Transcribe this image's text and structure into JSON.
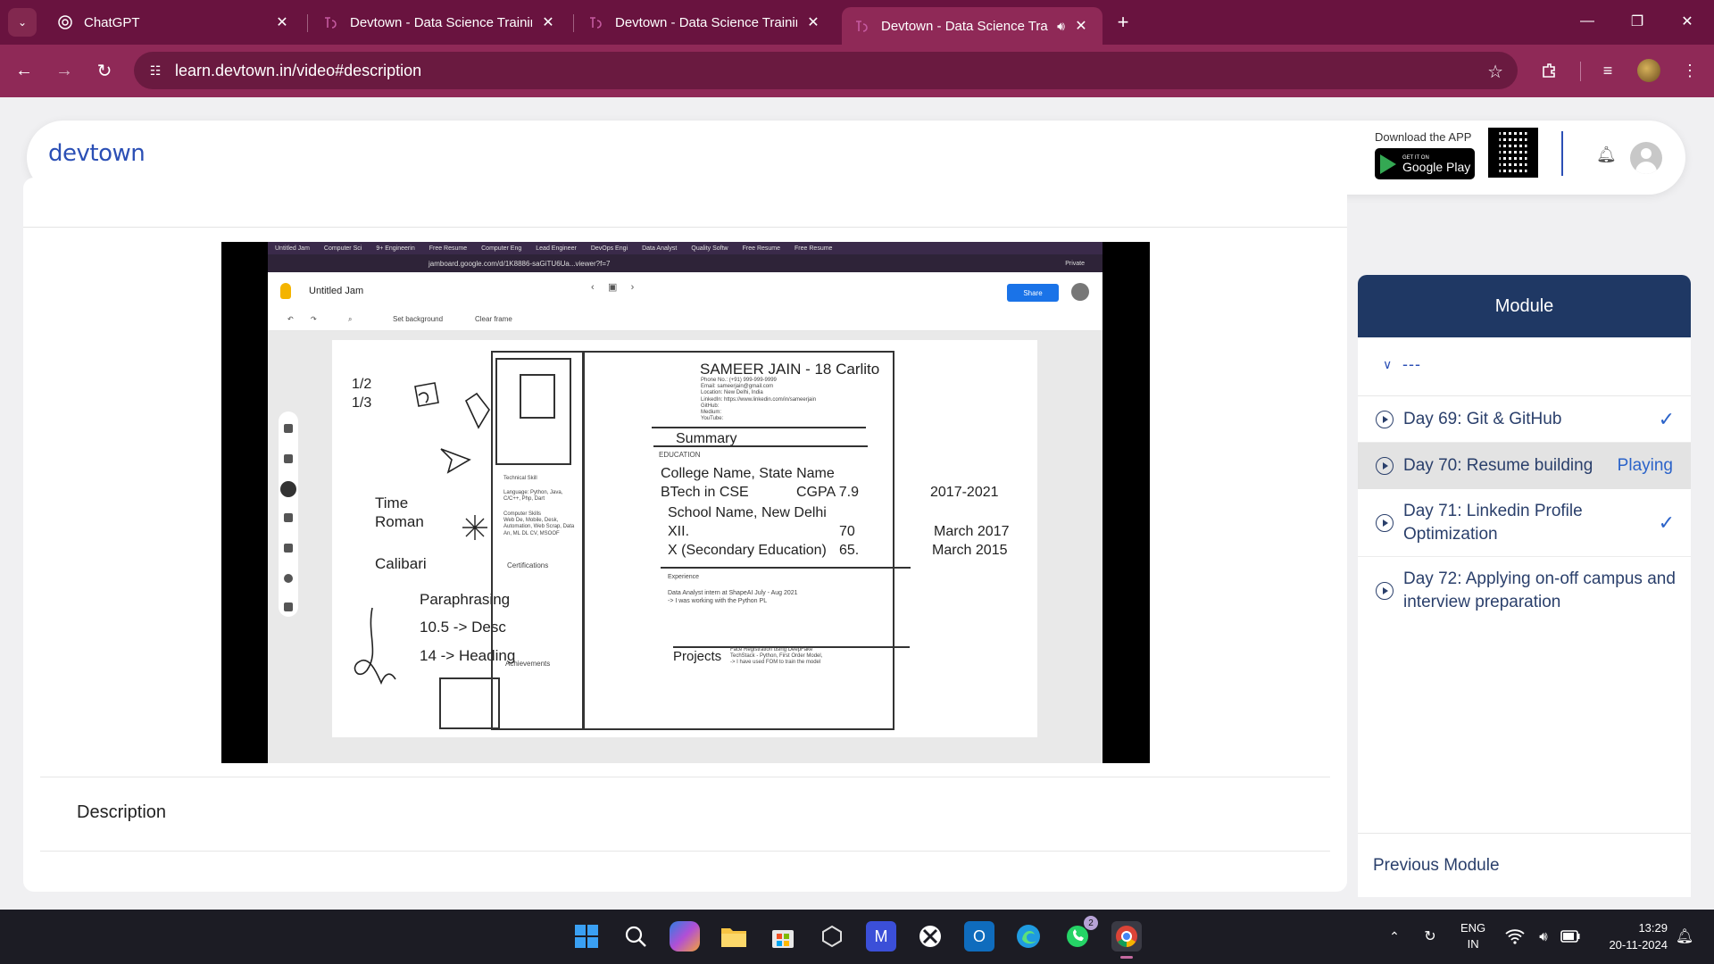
{
  "browser": {
    "tabs": [
      {
        "title": "ChatGPT",
        "icon": "chatgpt-icon"
      },
      {
        "title": "Devtown - Data Science Training",
        "icon": "devtown-icon"
      },
      {
        "title": "Devtown - Data Science Training",
        "icon": "devtown-icon"
      },
      {
        "title": "Devtown - Data Science Tra",
        "icon": "devtown-icon",
        "active": true
      }
    ],
    "url": "learn.devtown.in/video#description",
    "accent": "#8f2957",
    "tabstrip_color": "#69133f"
  },
  "header": {
    "logo": "devtown",
    "download_label": "Download the APP",
    "play_small": "GET IT ON",
    "play_big": "Google Play"
  },
  "video": {
    "jam_title": "Untitled Jam",
    "jam_url": "jamboard.google.com/d/1K8886-saGiTU6Ua...viewer?f=7",
    "share_label": "Share",
    "set_background": "Set background",
    "clear_frame": "Clear frame",
    "private_label": "Private",
    "board": {
      "name_line": "SAMEER JAIN - 18 Carlito",
      "ratio1": "1/2",
      "ratio2": "1/3",
      "font1": "Time\nRoman",
      "font2": "Calibari",
      "para1": "Paraphrasing",
      "para2": "10.5 -> Desc",
      "para3": "14 -> Heading",
      "summary": "Summary",
      "education": "EDUCATION",
      "college": "College Name, State Name",
      "btech": "BTech in CSE",
      "cgpa": "CGPA 7.9",
      "years": "2017-2021",
      "school": "School Name, New Delhi",
      "xii": "XII.",
      "xii_score": "70",
      "xii_date": "March 2017",
      "x": "X (Secondary Education)",
      "x_score": "65.",
      "x_date": "March 2015",
      "technical_skill": "Technical Skill",
      "languages": "Language: Python, Java, C/C++, Php, Dart",
      "computer_skills": "Computer Skills\nWeb De, Mobile, Desk, Automation, Web Scrap, Data An, ML DL CV, MSOOF",
      "certifications": "Certifications",
      "experience": "Experience",
      "exp_line": "Data Analyst intern at ShapeAI     July - Aug 2021",
      "exp_detail": "-> I was working with the Python PL",
      "achievements": "Achievements",
      "projects": "Projects",
      "project_detail": "Face Registration using DeepFake\nTechStack - Python, First Order Model,\n-> I have used FOM to train the model"
    }
  },
  "description": {
    "label": "Description"
  },
  "module": {
    "title": "Module",
    "section_label": "---",
    "lessons": [
      {
        "title": "Day 69: Git & GitHub",
        "status": "done"
      },
      {
        "title": "Day 70: Resume building",
        "status": "Playing"
      },
      {
        "title": "Day 71: Linkedin Profile Optimization",
        "status": "done"
      },
      {
        "title": "Day 72: Applying on-off campus and interview preparation",
        "status": ""
      }
    ],
    "previous_label": "Previous Module",
    "header_color": "#1f3864"
  },
  "taskbar": {
    "lang_top": "ENG",
    "lang_bottom": "IN",
    "time": "13:29",
    "date": "20-11-2024",
    "whatsapp_badge": "2"
  }
}
